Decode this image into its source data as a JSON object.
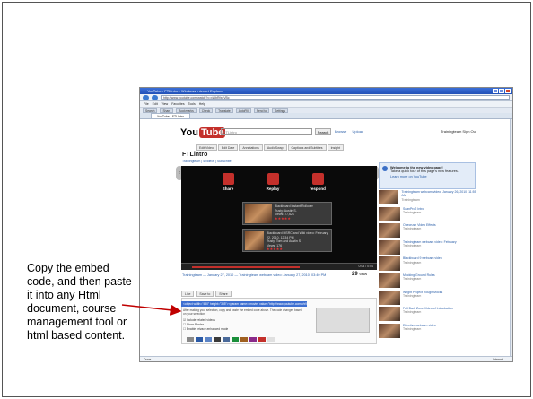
{
  "caption": "Copy the embed code, and then paste it into any Html document, course management tool or html based content.",
  "browser": {
    "window_title": "YouTube - FTLIntro - Windows Internet Explorer",
    "url": "http://www.youtube.com/watch?v=xWbRfxoVBc",
    "menu": [
      "File",
      "Edit",
      "View",
      "Favorites",
      "Tools",
      "Help"
    ],
    "toolbar_items": [
      "Search",
      "Share",
      "Bookmarks",
      "Check",
      "Translate",
      "AutoFill",
      "Send to",
      "Settings"
    ],
    "tab_label": "YouTube - FTLIntro",
    "status_left": "Done",
    "status_right": "Internet"
  },
  "youtube": {
    "logo_text": "You",
    "logo_tube": "Tube",
    "search_placeholder": "FTLintro",
    "search_button": "Search",
    "links": [
      "Browse",
      "Upload"
    ],
    "user_links": "Trainingteam  Sign Out",
    "edit_tabs": [
      "Edit Video",
      "Edit Date",
      "Annotations",
      "AudioSwap",
      "Captions and Subtitles",
      "Insight"
    ],
    "video_title": "FTLintro",
    "video_sub": "Trainingteam  |  4 videos  |  Subscribe",
    "end_actions": [
      "Share",
      "Replay",
      "respond"
    ],
    "related": [
      {
        "title": "Blackboard Instant Rollover",
        "meta": "Rusty: Austin S.",
        "views": "Views: 77,621"
      },
      {
        "title": "Blackboard MSRC and Wiki video: February 22, 2010, 12:34 PM",
        "meta": "Rusty: Tom and Austin S.",
        "views": "Views: 176"
      }
    ],
    "time": "0:04 / 0:04",
    "byline": "Trainingteam — January 27, 2010 — Trainingteam webcam video: January 27, 2010, 03:40 PM",
    "views": "29",
    "views_label": "views",
    "like_bar": [
      "Like",
      "Save to",
      "Share"
    ],
    "embed_code": "<object width=\"480\" height=\"385\"><param name=\"movie\" value=\"http://www.youtube.com/v/xWbR...",
    "embed_note": "After making your selection, copy and paste the embed code above. The code changes based on your selection.",
    "embed_options": [
      "Include related videos",
      "Show Border",
      "Enable privacy-enhanced mode"
    ],
    "swatch_colors": [
      "#888888",
      "#2b5aa6",
      "#5b83c5",
      "#3a3a3a",
      "#4a6a9a",
      "#1a8f3a",
      "#a06020",
      "#8a2a8a",
      "#c4302b",
      "#e0e0e0"
    ],
    "welcome_title": "Welcome to the new video page!",
    "welcome_text": "Take a quick tour of this page's new features.",
    "welcome_link": "Learn more on YouTube",
    "sidebar_videos": [
      {
        "title": "Trainingteam webcam video: January 26, 2010, 11:55 AM",
        "who": "Trainingteam"
      },
      {
        "title": "ScanPro2 Intro",
        "who": "Trainingteam"
      },
      {
        "title": "Onecrush Video Effects",
        "who": "Trainingteam"
      },
      {
        "title": "Trainingteam webcam video: February",
        "who": "Trainingteam"
      },
      {
        "title": "Blackboard 9 webcam video",
        "who": "Trainingteam"
      },
      {
        "title": "Mocking Ground Rules",
        "who": "Trainingteam"
      },
      {
        "title": "Wright Project Rough Mocks",
        "who": "Trainingteam"
      },
      {
        "title": "Full Dark Zone Video of Introduction",
        "who": "Trainingteam"
      },
      {
        "title": "Effective webcam video",
        "who": "Trainingteam"
      }
    ]
  }
}
